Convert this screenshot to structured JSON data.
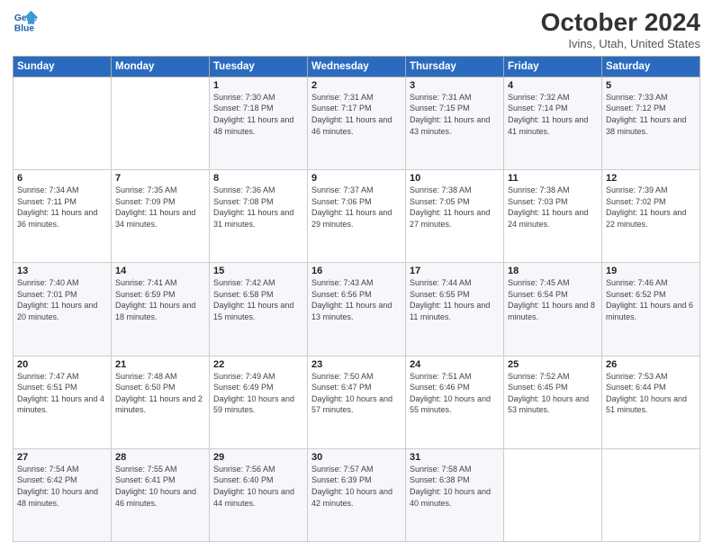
{
  "header": {
    "logo_line1": "General",
    "logo_line2": "Blue",
    "title": "October 2024",
    "subtitle": "Ivins, Utah, United States"
  },
  "days_of_week": [
    "Sunday",
    "Monday",
    "Tuesday",
    "Wednesday",
    "Thursday",
    "Friday",
    "Saturday"
  ],
  "weeks": [
    [
      {
        "day": "",
        "sunrise": "",
        "sunset": "",
        "daylight": ""
      },
      {
        "day": "",
        "sunrise": "",
        "sunset": "",
        "daylight": ""
      },
      {
        "day": "1",
        "sunrise": "Sunrise: 7:30 AM",
        "sunset": "Sunset: 7:18 PM",
        "daylight": "Daylight: 11 hours and 48 minutes."
      },
      {
        "day": "2",
        "sunrise": "Sunrise: 7:31 AM",
        "sunset": "Sunset: 7:17 PM",
        "daylight": "Daylight: 11 hours and 46 minutes."
      },
      {
        "day": "3",
        "sunrise": "Sunrise: 7:31 AM",
        "sunset": "Sunset: 7:15 PM",
        "daylight": "Daylight: 11 hours and 43 minutes."
      },
      {
        "day": "4",
        "sunrise": "Sunrise: 7:32 AM",
        "sunset": "Sunset: 7:14 PM",
        "daylight": "Daylight: 11 hours and 41 minutes."
      },
      {
        "day": "5",
        "sunrise": "Sunrise: 7:33 AM",
        "sunset": "Sunset: 7:12 PM",
        "daylight": "Daylight: 11 hours and 38 minutes."
      }
    ],
    [
      {
        "day": "6",
        "sunrise": "Sunrise: 7:34 AM",
        "sunset": "Sunset: 7:11 PM",
        "daylight": "Daylight: 11 hours and 36 minutes."
      },
      {
        "day": "7",
        "sunrise": "Sunrise: 7:35 AM",
        "sunset": "Sunset: 7:09 PM",
        "daylight": "Daylight: 11 hours and 34 minutes."
      },
      {
        "day": "8",
        "sunrise": "Sunrise: 7:36 AM",
        "sunset": "Sunset: 7:08 PM",
        "daylight": "Daylight: 11 hours and 31 minutes."
      },
      {
        "day": "9",
        "sunrise": "Sunrise: 7:37 AM",
        "sunset": "Sunset: 7:06 PM",
        "daylight": "Daylight: 11 hours and 29 minutes."
      },
      {
        "day": "10",
        "sunrise": "Sunrise: 7:38 AM",
        "sunset": "Sunset: 7:05 PM",
        "daylight": "Daylight: 11 hours and 27 minutes."
      },
      {
        "day": "11",
        "sunrise": "Sunrise: 7:38 AM",
        "sunset": "Sunset: 7:03 PM",
        "daylight": "Daylight: 11 hours and 24 minutes."
      },
      {
        "day": "12",
        "sunrise": "Sunrise: 7:39 AM",
        "sunset": "Sunset: 7:02 PM",
        "daylight": "Daylight: 11 hours and 22 minutes."
      }
    ],
    [
      {
        "day": "13",
        "sunrise": "Sunrise: 7:40 AM",
        "sunset": "Sunset: 7:01 PM",
        "daylight": "Daylight: 11 hours and 20 minutes."
      },
      {
        "day": "14",
        "sunrise": "Sunrise: 7:41 AM",
        "sunset": "Sunset: 6:59 PM",
        "daylight": "Daylight: 11 hours and 18 minutes."
      },
      {
        "day": "15",
        "sunrise": "Sunrise: 7:42 AM",
        "sunset": "Sunset: 6:58 PM",
        "daylight": "Daylight: 11 hours and 15 minutes."
      },
      {
        "day": "16",
        "sunrise": "Sunrise: 7:43 AM",
        "sunset": "Sunset: 6:56 PM",
        "daylight": "Daylight: 11 hours and 13 minutes."
      },
      {
        "day": "17",
        "sunrise": "Sunrise: 7:44 AM",
        "sunset": "Sunset: 6:55 PM",
        "daylight": "Daylight: 11 hours and 11 minutes."
      },
      {
        "day": "18",
        "sunrise": "Sunrise: 7:45 AM",
        "sunset": "Sunset: 6:54 PM",
        "daylight": "Daylight: 11 hours and 8 minutes."
      },
      {
        "day": "19",
        "sunrise": "Sunrise: 7:46 AM",
        "sunset": "Sunset: 6:52 PM",
        "daylight": "Daylight: 11 hours and 6 minutes."
      }
    ],
    [
      {
        "day": "20",
        "sunrise": "Sunrise: 7:47 AM",
        "sunset": "Sunset: 6:51 PM",
        "daylight": "Daylight: 11 hours and 4 minutes."
      },
      {
        "day": "21",
        "sunrise": "Sunrise: 7:48 AM",
        "sunset": "Sunset: 6:50 PM",
        "daylight": "Daylight: 11 hours and 2 minutes."
      },
      {
        "day": "22",
        "sunrise": "Sunrise: 7:49 AM",
        "sunset": "Sunset: 6:49 PM",
        "daylight": "Daylight: 10 hours and 59 minutes."
      },
      {
        "day": "23",
        "sunrise": "Sunrise: 7:50 AM",
        "sunset": "Sunset: 6:47 PM",
        "daylight": "Daylight: 10 hours and 57 minutes."
      },
      {
        "day": "24",
        "sunrise": "Sunrise: 7:51 AM",
        "sunset": "Sunset: 6:46 PM",
        "daylight": "Daylight: 10 hours and 55 minutes."
      },
      {
        "day": "25",
        "sunrise": "Sunrise: 7:52 AM",
        "sunset": "Sunset: 6:45 PM",
        "daylight": "Daylight: 10 hours and 53 minutes."
      },
      {
        "day": "26",
        "sunrise": "Sunrise: 7:53 AM",
        "sunset": "Sunset: 6:44 PM",
        "daylight": "Daylight: 10 hours and 51 minutes."
      }
    ],
    [
      {
        "day": "27",
        "sunrise": "Sunrise: 7:54 AM",
        "sunset": "Sunset: 6:42 PM",
        "daylight": "Daylight: 10 hours and 48 minutes."
      },
      {
        "day": "28",
        "sunrise": "Sunrise: 7:55 AM",
        "sunset": "Sunset: 6:41 PM",
        "daylight": "Daylight: 10 hours and 46 minutes."
      },
      {
        "day": "29",
        "sunrise": "Sunrise: 7:56 AM",
        "sunset": "Sunset: 6:40 PM",
        "daylight": "Daylight: 10 hours and 44 minutes."
      },
      {
        "day": "30",
        "sunrise": "Sunrise: 7:57 AM",
        "sunset": "Sunset: 6:39 PM",
        "daylight": "Daylight: 10 hours and 42 minutes."
      },
      {
        "day": "31",
        "sunrise": "Sunrise: 7:58 AM",
        "sunset": "Sunset: 6:38 PM",
        "daylight": "Daylight: 10 hours and 40 minutes."
      },
      {
        "day": "",
        "sunrise": "",
        "sunset": "",
        "daylight": ""
      },
      {
        "day": "",
        "sunrise": "",
        "sunset": "",
        "daylight": ""
      }
    ]
  ]
}
